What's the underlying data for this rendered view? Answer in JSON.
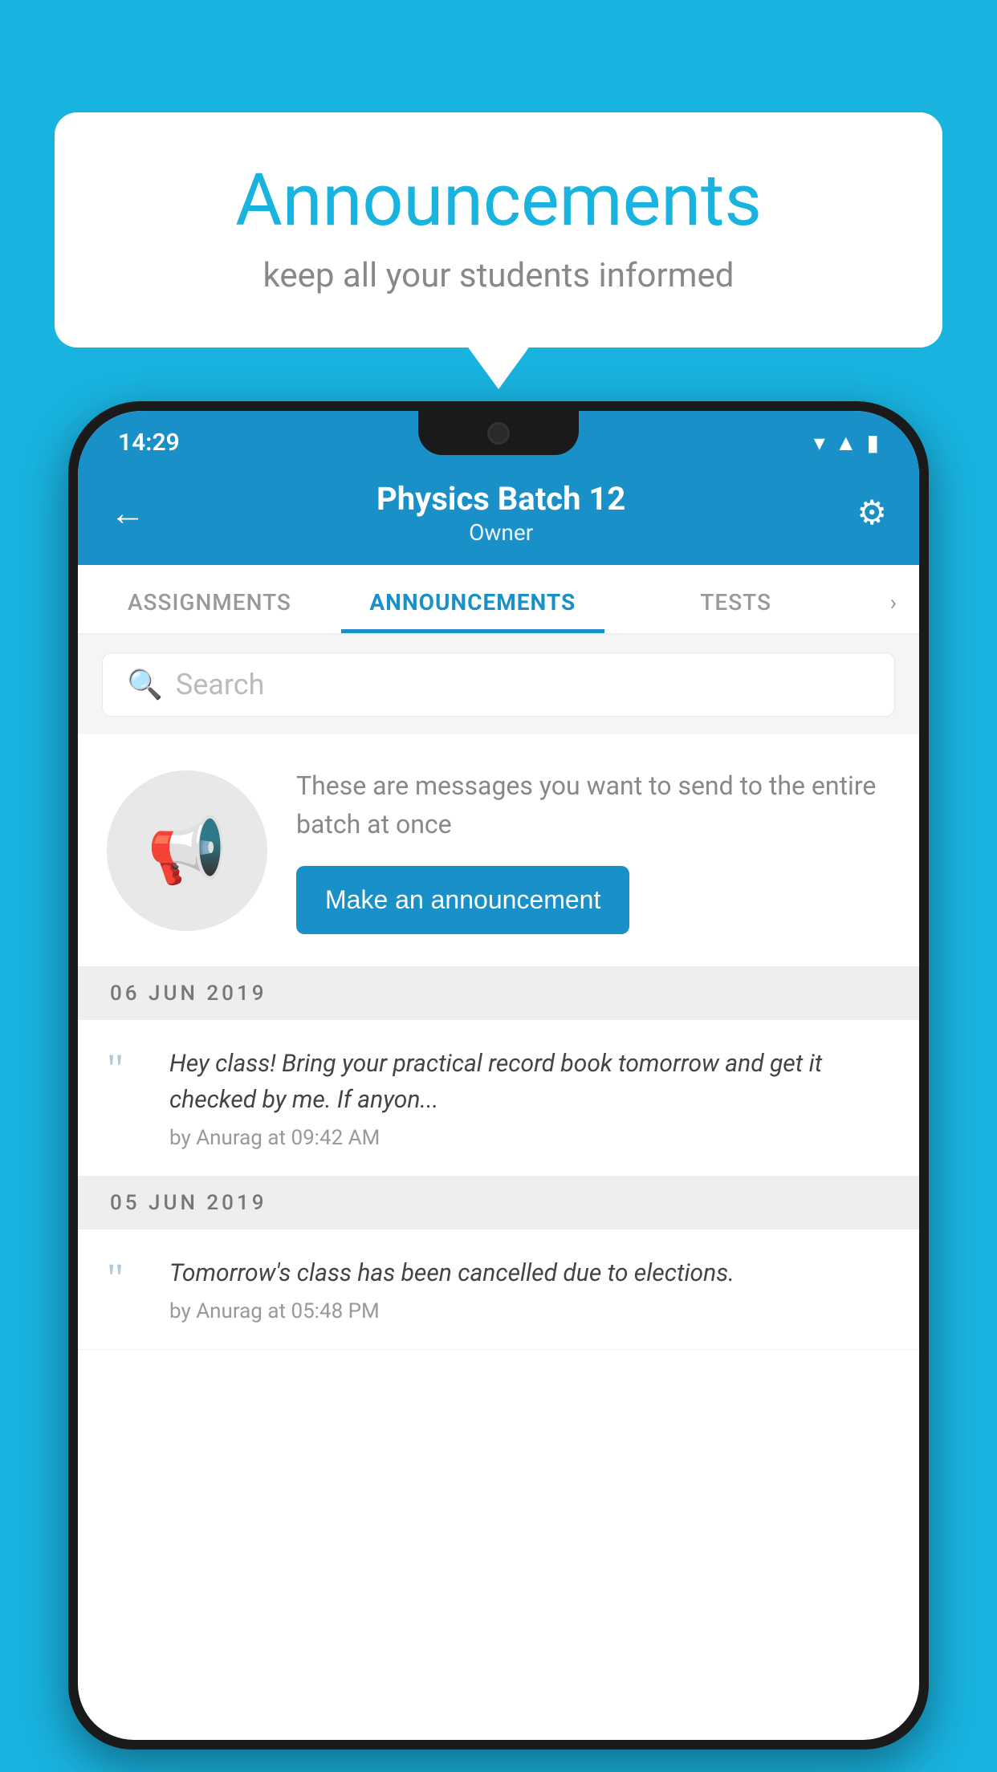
{
  "background_color": "#19b3e0",
  "speech_bubble": {
    "title": "Announcements",
    "subtitle": "keep all your students informed"
  },
  "status_bar": {
    "time": "14:29",
    "icons": [
      "wifi",
      "signal",
      "battery"
    ]
  },
  "header": {
    "title": "Physics Batch 12",
    "subtitle": "Owner",
    "back_label": "←",
    "settings_label": "⚙"
  },
  "tabs": [
    {
      "label": "ASSIGNMENTS",
      "active": false
    },
    {
      "label": "ANNOUNCEMENTS",
      "active": true
    },
    {
      "label": "TESTS",
      "active": false
    }
  ],
  "search": {
    "placeholder": "Search"
  },
  "announcement_promo": {
    "description": "These are messages you want to send to the entire batch at once",
    "button_label": "Make an announcement"
  },
  "announcements": [
    {
      "date": "06  JUN  2019",
      "message": "Hey class! Bring your practical record book tomorrow and get it checked by me. If anyon...",
      "meta": "by Anurag at 09:42 AM"
    },
    {
      "date": "05  JUN  2019",
      "message": "Tomorrow's class has been cancelled due to elections.",
      "meta": "by Anurag at 05:48 PM"
    }
  ]
}
